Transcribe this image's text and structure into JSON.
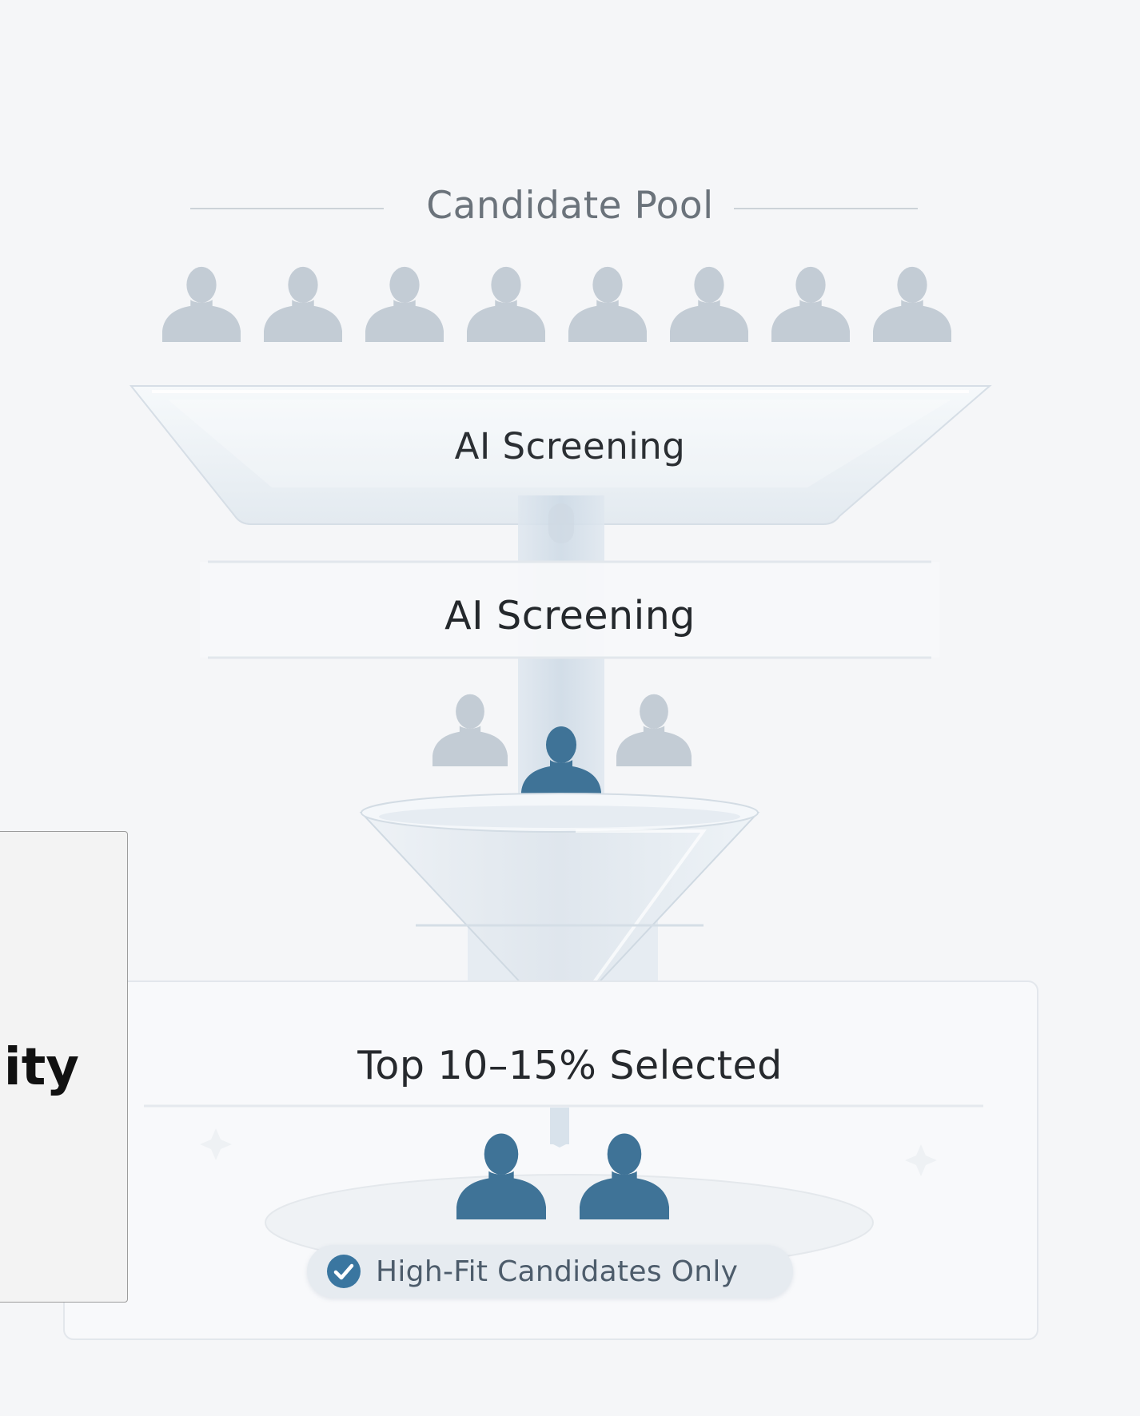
{
  "diagram": {
    "pool_title": "Candidate Pool",
    "stage_1_label": "AI Screening",
    "stage_2_label": "AI Screening",
    "result_label": "Top 10–15% Selected",
    "badge_label": "High-Fit Candidates Only",
    "pool_count": 8,
    "shortlist_count": 3,
    "selected_count": 2
  },
  "side_panel": {
    "partial_text": "lity"
  },
  "colors": {
    "background": "#f5f6f8",
    "person_gray": "#c3ccd5",
    "person_blue": "#3f7397",
    "check_blue": "#3a76a0",
    "funnel_light": "#eaf0f5"
  },
  "icons": {
    "person": "person-icon",
    "selected_person": "selected-person-icon",
    "check": "check-circle-icon"
  }
}
